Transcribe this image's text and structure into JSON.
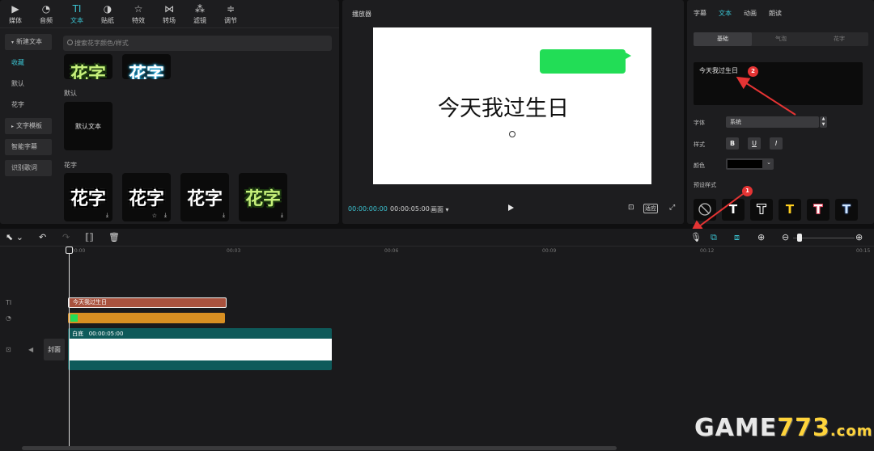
{
  "toolbar": {
    "items": [
      {
        "label": "媒体",
        "icon": "media-icon"
      },
      {
        "label": "音频",
        "icon": "audio-icon"
      },
      {
        "label": "文本",
        "icon": "text-icon"
      },
      {
        "label": "贴纸",
        "icon": "sticker-icon"
      },
      {
        "label": "特效",
        "icon": "effects-icon"
      },
      {
        "label": "转场",
        "icon": "transition-icon"
      },
      {
        "label": "滤镜",
        "icon": "filter-icon"
      },
      {
        "label": "调节",
        "icon": "adjust-icon"
      }
    ],
    "active_index": 2,
    "text_glyph": "TI"
  },
  "side_nav": {
    "new_text": "新建文本",
    "favorites": "收藏",
    "default": "默认",
    "fancy": "花字",
    "text_template": "文字模板",
    "smart_subtitle": "智能字幕",
    "lyrics": "识别歌词"
  },
  "search": {
    "placeholder": "搜索花字颜色/样式"
  },
  "library": {
    "partial_glyph": "花字",
    "default_section": "默认",
    "default_tile": "默认文本",
    "fancy_section": "花字",
    "fancy_glyph": "花字"
  },
  "player": {
    "title": "播放器",
    "canvas_text": "今天我过生日",
    "current_time": "00:00:00:00",
    "total_time": "00:00:05:00",
    "ratio": "画面",
    "original_btn": "适应"
  },
  "inspector": {
    "tabs": [
      "字幕",
      "文本",
      "动画",
      "朗读"
    ],
    "active_tab": 1,
    "segments": [
      "基础",
      "气泡",
      "花字"
    ],
    "active_segment": 0,
    "text_value": "今天我过生日",
    "font_label": "字体",
    "font_value": "系统",
    "style_label": "样式",
    "style_buttons": [
      "B",
      "U",
      "I"
    ],
    "color_label": "颜色",
    "color_value": "#000000",
    "preset_label": "预设样式",
    "preset_glyph": "T",
    "badges": [
      "1",
      "2"
    ]
  },
  "timeline": {
    "ruler": [
      "00:00",
      "00:03",
      "00:06",
      "00:09",
      "00:12",
      "00:15"
    ],
    "text_clip": "今天我过生日",
    "video_clip_name": "白底",
    "video_clip_duration": "00:00:05:00",
    "cover_btn": "封面",
    "track_text_glyph": "TI"
  },
  "watermark": {
    "brand": "GAME",
    "nums": "773",
    "com": ".com"
  }
}
